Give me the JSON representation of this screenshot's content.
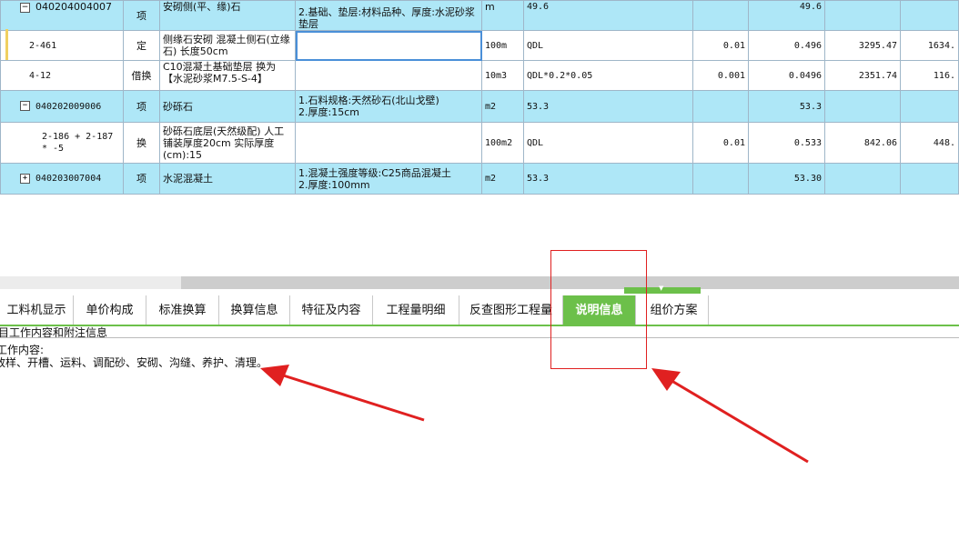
{
  "rows": [
    {
      "code": "040204004007",
      "tree": "−",
      "type": "项",
      "name": "安砌侧(平、缘)石",
      "feature": "2.基础、垫层:材料品种、厚度:水泥砂浆垫层",
      "unit": "m",
      "qty_expr": "49.6",
      "coef": "",
      "qty": "49.6",
      "price": "",
      "total": ""
    },
    {
      "code": "2-461",
      "tree": "",
      "type": "定",
      "name": "侧缘石安砌 混凝土侧石(立缘石) 长度50cm",
      "feature": "",
      "unit": "100m",
      "qty_expr": "QDL",
      "coef": "0.01",
      "qty": "0.496",
      "price": "3295.47",
      "total": "1634."
    },
    {
      "code": "4-12",
      "tree": "",
      "type": "借换",
      "name": "C10混凝土基础垫层  换为【水泥砂浆M7.5-S-4】",
      "feature": "",
      "unit": "10m3",
      "qty_expr": "QDL*0.2*0.05",
      "coef": "0.001",
      "qty": "0.0496",
      "price": "2351.74",
      "total": "116."
    },
    {
      "code": "040202009006",
      "tree": "−",
      "type": "项",
      "name": "砂砾石",
      "feature": "1.石料规格:天然砂石(北山戈壁)\n2.厚度:15cm",
      "unit": "m2",
      "qty_expr": "53.3",
      "coef": "",
      "qty": "53.3",
      "price": "",
      "total": ""
    },
    {
      "code": "2-186 + 2-187 * -5",
      "tree": "",
      "type": "换",
      "name": "砂砾石底层(天然级配) 人工铺装厚度20cm  实际厚度(cm):15",
      "feature": "",
      "unit": "100m2",
      "qty_expr": "QDL",
      "coef": "0.01",
      "qty": "0.533",
      "price": "842.06",
      "total": "448."
    },
    {
      "code": "040203007004",
      "tree": "+",
      "type": "项",
      "name": "水泥混凝土",
      "feature": "1.混凝土强度等级:C25商品混凝土\n2.厚度:100mm",
      "unit": "m2",
      "qty_expr": "53.3",
      "coef": "",
      "qty": "53.30",
      "price": "",
      "total": ""
    }
  ],
  "tabs": [
    {
      "label": "工料机显示",
      "active": false
    },
    {
      "label": "单价构成",
      "active": false
    },
    {
      "label": "标准换算",
      "active": false
    },
    {
      "label": "换算信息",
      "active": false
    },
    {
      "label": "特征及内容",
      "active": false
    },
    {
      "label": "工程量明细",
      "active": false
    },
    {
      "label": "反查图形工程量",
      "active": false
    },
    {
      "label": "说明信息",
      "active": true
    },
    {
      "label": "组价方案",
      "active": false
    }
  ],
  "info": {
    "section_title": "目工作内容和附注信息",
    "content_label": "工作内容:",
    "content_text": "放样、开槽、运料、调配砂、安砌、沟缝、养护、清理。"
  },
  "colors": {
    "highlight_row": "#aee7f7",
    "active_tab": "#6cc04a",
    "annotation": "#e02020"
  }
}
